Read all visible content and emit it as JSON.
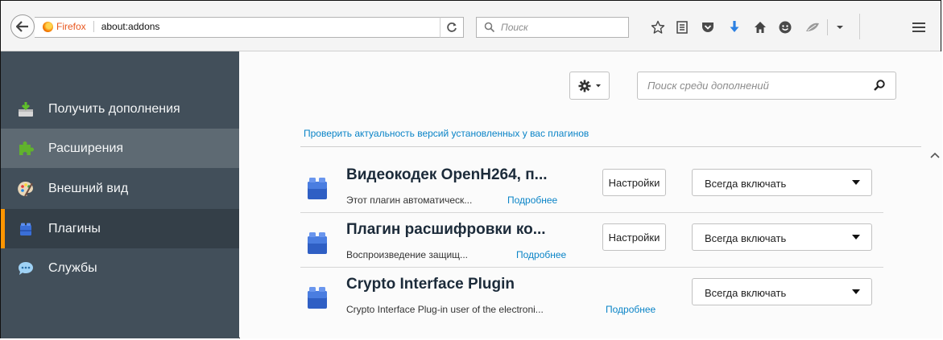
{
  "toolbar": {
    "identity_label": "Firefox",
    "url": "about:addons",
    "search_placeholder": "Поиск"
  },
  "sidebar": {
    "items": [
      {
        "label": "Получить дополнения",
        "icon": "get-addons-icon"
      },
      {
        "label": "Расширения",
        "icon": "puzzle-icon"
      },
      {
        "label": "Внешний вид",
        "icon": "palette-icon"
      },
      {
        "label": "Плагины",
        "icon": "plugin-icon"
      },
      {
        "label": "Службы",
        "icon": "chat-bubble-icon"
      }
    ],
    "selected": "Плагины"
  },
  "main": {
    "addon_search_placeholder": "Поиск среди дополнений",
    "check_plugins_link": "Проверить актуальность версий установленных у вас плагинов",
    "plugins": [
      {
        "name": "Видеокодек OpenH264, п...",
        "description": "Этот плагин автоматическ...",
        "more": "Подробнее",
        "settings": "Настройки",
        "state": "Всегда включать"
      },
      {
        "name": "Плагин расшифровки ко...",
        "description": "Воспроизведение защищ...",
        "more": "Подробнее",
        "settings": "Настройки",
        "state": "Всегда включать"
      },
      {
        "name": "Crypto Interface Plugin",
        "description": "Crypto Interface Plug-in user of the electroni...",
        "more": "Подробнее",
        "state": "Всегда включать"
      }
    ]
  },
  "colors": {
    "sidebar_bg": "#424f5a",
    "selected_accent": "#ff9500",
    "link": "#0a84c7"
  }
}
